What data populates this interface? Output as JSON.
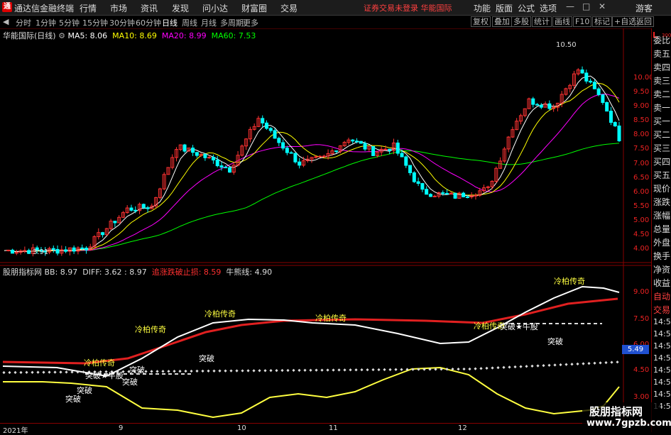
{
  "window": {
    "logo_icon": "app-logo-icon",
    "app_name": "通达信金融终端",
    "menus": [
      "行情",
      "市场",
      "资讯",
      "发现",
      "问小达",
      "财富圈",
      "交易"
    ],
    "login_alert": "证券交易未登录  华能国际",
    "right_menus": [
      "功能",
      "版面",
      "公式",
      "选项"
    ],
    "guest": "游客",
    "alert_color": "#ff4040"
  },
  "periods": {
    "items": [
      "分时",
      "1分钟",
      "5分钟",
      "15分钟",
      "30分钟",
      "60分钟",
      "日线",
      "周线",
      "月线",
      "多周期",
      "更多"
    ],
    "active": "日线",
    "tools": [
      "复权",
      "叠加",
      "多股",
      "统计",
      "画线",
      "F10",
      "标记",
      "+自选",
      "返回"
    ]
  },
  "main_chart": {
    "title": "华能国际(日线)",
    "ma_labels": [
      "MA5: 8.06",
      "MA10: 8.69",
      "MA20: 8.99",
      "MA60: 7.53"
    ],
    "ma_colors": [
      "#ffffff",
      "#ffff00",
      "#ff00ff",
      "#00ff00"
    ],
    "y_ticks": [
      "10.00",
      "9.50",
      "9.00",
      "8.50",
      "8.00",
      "7.50",
      "7.00",
      "6.50",
      "6.00",
      "5.50",
      "5.00",
      "4.50",
      "4.00"
    ],
    "high_label": "10.50",
    "low_label": "3.91",
    "corner_label": "L",
    "corner_sub": "300"
  },
  "indicator": {
    "title": "股朋指标网",
    "bb": "BB: 8.97",
    "diff": "DIFF: 3.62 : 8.97",
    "stop": "追涨跌破止损: 8.59",
    "bull": "牛熊线: 4.90",
    "y_ticks": [
      "9.00",
      "7.50",
      "6.00",
      "4.50",
      "3.00"
    ],
    "current_value": "5.49",
    "annotations": [
      "冷柏传奇",
      "冷柏传奇",
      "冷柏传奇",
      "冷柏传奇",
      "冷柏传奇",
      "冷柏传奇",
      "突破",
      "突破",
      "突破",
      "突破",
      "突破",
      "突破",
      "突破★牛股",
      "突破★牛股"
    ]
  },
  "x_axis": [
    "2021年",
    "9",
    "10",
    "11",
    "12"
  ],
  "right_panel": [
    "委比",
    "卖五",
    "卖四",
    "卖三",
    "卖二",
    "卖一",
    "买一",
    "买二",
    "买三",
    "买四",
    "买五",
    "现价",
    "涨跌",
    "涨幅",
    "总量",
    "外盘",
    "换手",
    "净资",
    "收益",
    "自动",
    "交易",
    "14:56",
    "14:56",
    "14:56",
    "14:56",
    "14:56",
    "14:56",
    "14:56",
    "14:56"
  ],
  "watermark": {
    "line1": "股朋指标网",
    "line2": "www.7gpzb.com"
  }
}
